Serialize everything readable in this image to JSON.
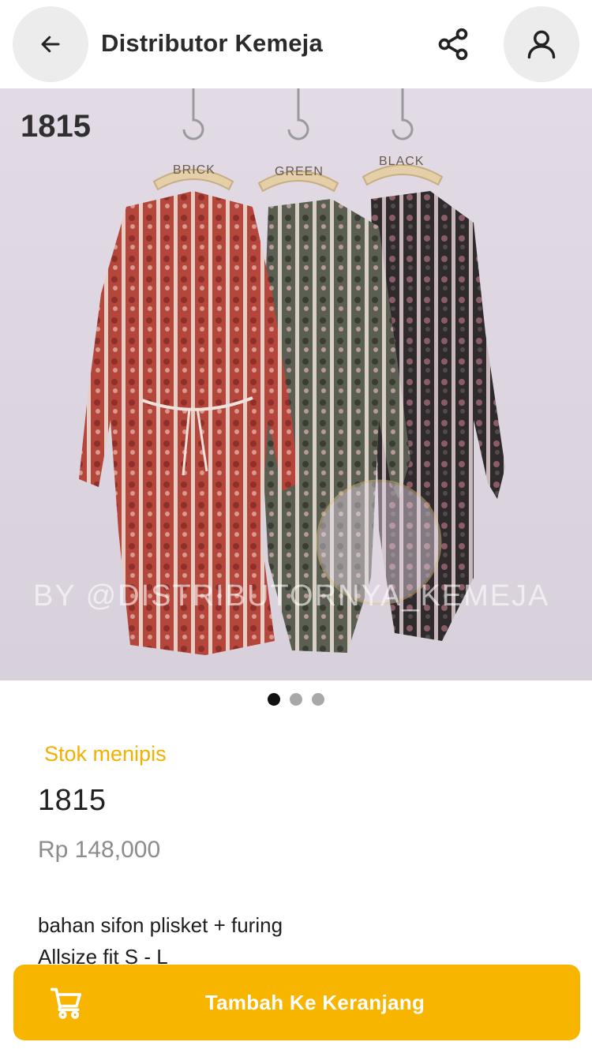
{
  "header": {
    "title": "Distributor Kemeja",
    "back_icon": "arrow-left-icon",
    "share_icon": "share-icon",
    "profile_icon": "user-icon"
  },
  "gallery": {
    "label_number": "1815",
    "hanger_labels": [
      "BRICK",
      "GREEN",
      "BLACK"
    ],
    "watermark": "BY @DISTRIBUTORNYA_KEMEJA",
    "total_images": 3,
    "active_index": 0
  },
  "product": {
    "stock_status": "Stok menipis",
    "name": "1815",
    "price": "Rp 148,000",
    "description_lines": [
      "bahan sifon plisket + furing",
      "Allsize fit S - L"
    ]
  },
  "cart_button": {
    "label": "Tambah Ke Keranjang",
    "icon": "cart-icon"
  },
  "colors": {
    "accent": "#f7b500",
    "stock_text": "#f2b000",
    "price_text": "#8c8c8c"
  }
}
